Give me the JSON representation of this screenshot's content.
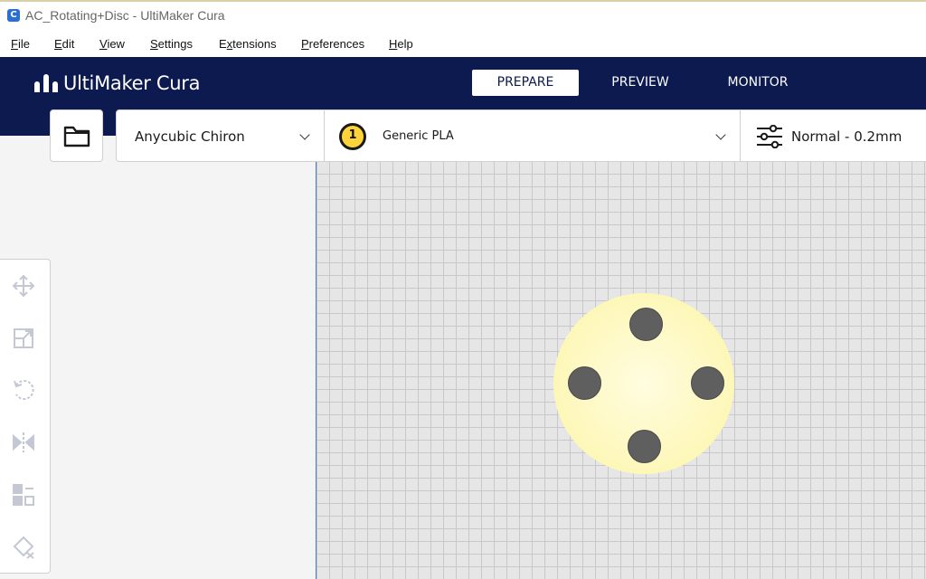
{
  "window": {
    "title": "AC_Rotating+Disc - UltiMaker Cura",
    "app_icon_letter": "C"
  },
  "menu": {
    "items": [
      {
        "pre": "",
        "ul": "F",
        "post": "ile"
      },
      {
        "pre": "",
        "ul": "E",
        "post": "dit"
      },
      {
        "pre": "",
        "ul": "V",
        "post": "iew"
      },
      {
        "pre": "",
        "ul": "S",
        "post": "ettings"
      },
      {
        "pre": "E",
        "ul": "x",
        "post": "tensions"
      },
      {
        "pre": "",
        "ul": "P",
        "post": "references"
      },
      {
        "pre": "",
        "ul": "H",
        "post": "elp"
      }
    ]
  },
  "header": {
    "logo_text": "UltiMaker Cura",
    "tabs": [
      {
        "label": "PREPARE",
        "active": true
      },
      {
        "label": "PREVIEW",
        "active": false
      },
      {
        "label": "MONITOR",
        "active": false
      }
    ]
  },
  "toolbar": {
    "open_icon": "folder-icon",
    "printer": "Anycubic Chiron",
    "extruder_number": "1",
    "material": "Generic PLA",
    "profile": "Normal - 0.2mm",
    "profile_icon": "sliders-icon"
  },
  "tools": [
    "move-icon",
    "scale-icon",
    "rotate-icon",
    "mirror-icon",
    "per-model-settings-icon",
    "support-blocker-icon"
  ],
  "colors": {
    "header_bg": "#0c1a4f",
    "build_plate": "#e6e6e6",
    "model": "#fdf7b8",
    "holes": "#5f5f5f",
    "extruder_badge": "#ffd43a"
  }
}
